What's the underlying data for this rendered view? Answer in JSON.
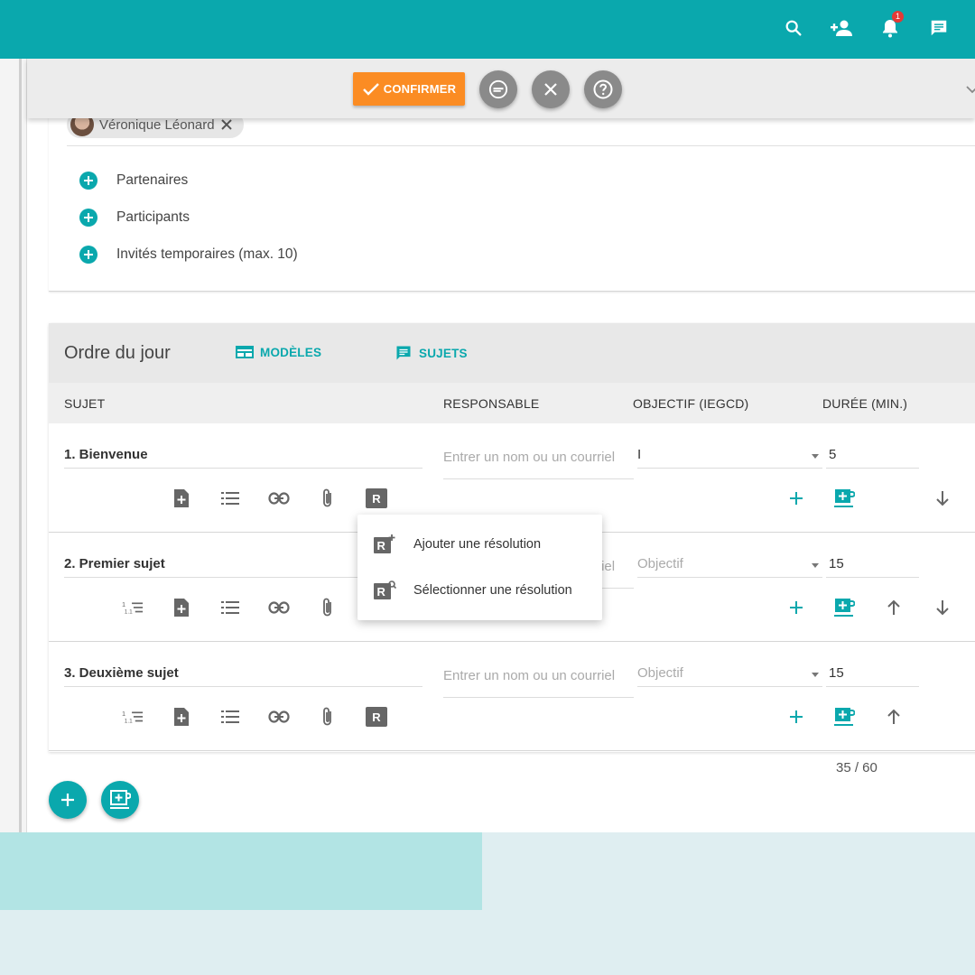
{
  "topbar": {
    "icons": [
      "search-icon",
      "add-user-icon",
      "bell-icon",
      "chat-icon"
    ],
    "notification_count": "1"
  },
  "actionbar": {
    "confirm_label": "CONFIRMER",
    "round_buttons": [
      "minus-icon",
      "close-icon",
      "help-icon"
    ]
  },
  "participants": {
    "chip_name": "Véronique Léonard",
    "rows": [
      "Partenaires",
      "Participants",
      "Invités temporaires (max. 10)"
    ]
  },
  "agenda": {
    "title": "Ordre du jour",
    "templates_label": "MODÈLES",
    "topics_label": "SUJETS",
    "columns": {
      "subject": "SUJET",
      "owner": "RESPONSABLE",
      "objective": "OBJECTIF (IEGCD)",
      "duration": "DURÉE (MIN.)"
    },
    "rows": [
      {
        "title": "1. Bienvenue",
        "owner_placeholder": "Entrer un nom ou un courriel",
        "objective": "I",
        "duration": "5"
      },
      {
        "title": "2. Premier sujet",
        "owner_placeholder": "Entrer un nom ou un courriel",
        "objective": "Objectif",
        "duration": "15"
      },
      {
        "title": "3. Deuxième sujet",
        "owner_placeholder": "Entrer un nom ou un courriel",
        "objective": "Objectif",
        "duration": "15"
      }
    ],
    "resolution_letter": "R",
    "total": "35 / 60"
  },
  "popup": {
    "items": [
      "Ajouter une résolution",
      "Sélectionner une résolution"
    ]
  },
  "colors": {
    "primary": "#0aa8ad",
    "confirm": "#fb8c23",
    "grey_button": "#8a8a8a"
  }
}
